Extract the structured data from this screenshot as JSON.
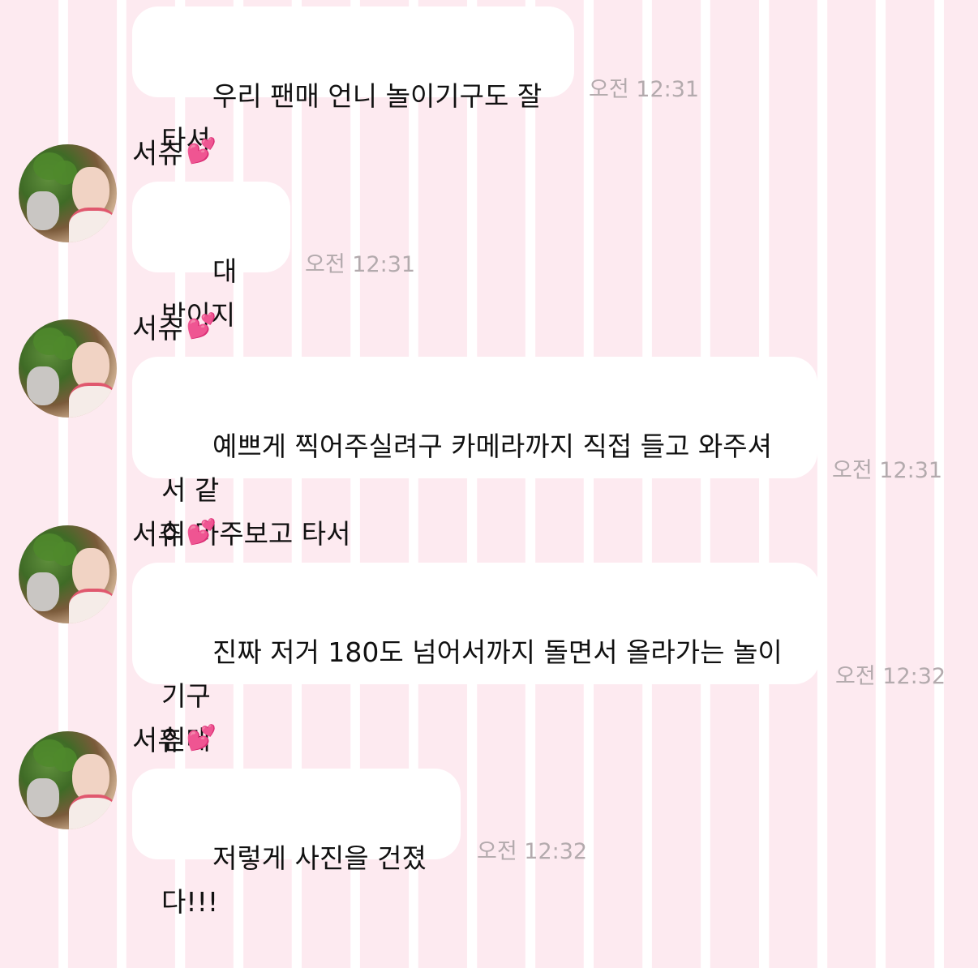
{
  "messages": [
    {
      "sender": "",
      "text": "우리 팬매 언니 놀이기구도 잘타셔",
      "time": "오전 12:31"
    },
    {
      "sender": "서츄",
      "heart": "💕",
      "text": "대박이지",
      "time": "오전 12:31"
    },
    {
      "sender": "서츄",
      "heart": "💕",
      "text": "예쁘게 찍어주실려구 카메라까지 직접 들고 와주셔서 같\n이 마주보고 타서",
      "time": "오전 12:31"
    },
    {
      "sender": "서츄",
      "heart": "💕",
      "text": "진짜 저거 180도 넘어서까지 돌면서 올라가는 놀이기구\n인데",
      "time": "오전 12:32"
    },
    {
      "sender": "서츄",
      "heart": "💕",
      "text": "저렇게 사진을 건졌다!!!",
      "time": "오전 12:32"
    }
  ],
  "colors": {
    "background_stripe": "#fdeaf0",
    "bubble": "#ffffff",
    "timestamp": "#b3aaad"
  },
  "icons": {
    "heart": "two-hearts-icon",
    "avatar": "profile-photo"
  }
}
